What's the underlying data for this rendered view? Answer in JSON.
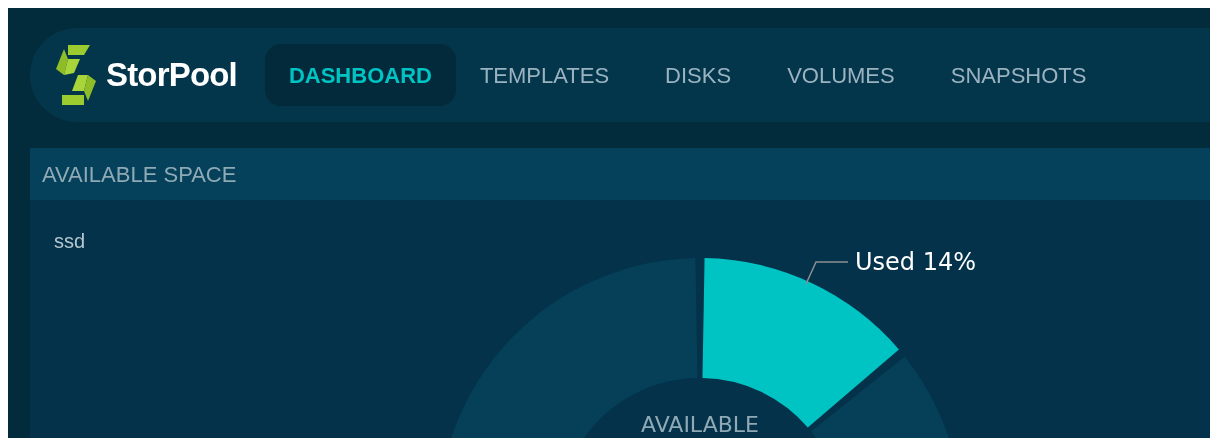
{
  "brand": "StorPool",
  "nav": [
    {
      "label": "DASHBOARD",
      "selected": true
    },
    {
      "label": "TEMPLATES",
      "selected": false
    },
    {
      "label": "DISKS",
      "selected": false
    },
    {
      "label": "VOLUMES",
      "selected": false
    },
    {
      "label": "SNAPSHOTS",
      "selected": false
    }
  ],
  "panel": {
    "title": "AVAILABLE SPACE",
    "pool": "ssd",
    "center_label": "AVAILABLE",
    "chart_data": {
      "type": "donut",
      "values": [
        14,
        86
      ],
      "value_labels": [
        "Used 14%",
        null
      ]
    }
  }
}
